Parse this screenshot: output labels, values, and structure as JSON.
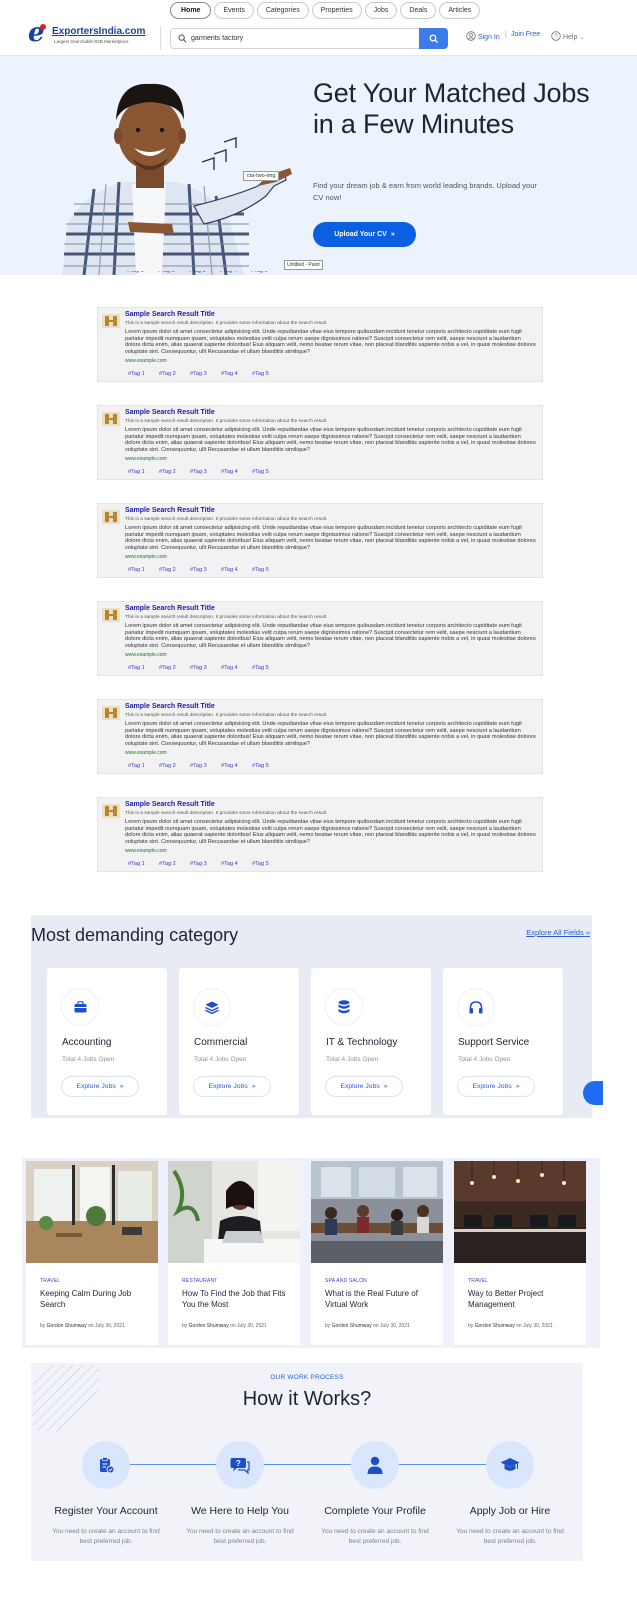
{
  "header": {
    "tabs": [
      "Home",
      "Events",
      "Categories",
      "Properties",
      "Jobs",
      "Deals",
      "Articles"
    ],
    "logo_name": "ExportersIndia.com",
    "logo_tagline": "Largest Searchable B2B Marketplace",
    "search_value": "garments factory",
    "sign_in": "Sign In",
    "divider": "|",
    "join_free": "Join Free",
    "help": "Help"
  },
  "hero": {
    "title": "Get Your Matched Jobs in a Few Minutes",
    "subtitle": "Find your dream job & earn from world leading brands. Upload your CV now!",
    "button": "Upload Your CV",
    "img_label": "cta-two-img",
    "paint_label": "Untitled - Paint"
  },
  "results": {
    "title": "Sample Search Result Title",
    "description": "This is a sample search result description. It provides some information about the search result.",
    "body": "Lorem ipsum dolor sit amet consectetur adipisicing elit. Unde repudiandae vitae eius tempore quibusdam incidunt tenetur corporis architecto cupiditate eum fugit pariatur impedit numquam ipsam, voluptates molestias velit culpa rerum saepe dignissimos ratione? Suscipit consectetur rem velit, saepe nesciunt a laudantium dolore dicta enim, alias quaerat sapiente doloribus! Eius aliquam velit, nemo beatae rerum vitae, non placeat blanditiis sapiente nobis a vel, in quasi molestiae dolores voluptate sint. Consequuntur, ullt Recusandae et ullam blanditiis similique?",
    "url": "www.example.com",
    "tags": [
      "#Tag 1",
      "#Tag 2",
      "#Tag 3",
      "#Tag 4",
      "#Tag 5"
    ]
  },
  "category": {
    "title": "Most demanding category",
    "explore_all": "Explore All Fields",
    "items": [
      {
        "name": "Accounting",
        "count": "Total 4 Jobs Open",
        "button": "Explore Jobs",
        "icon": "briefcase-icon"
      },
      {
        "name": "Commercial",
        "count": "Total 4 Jobs Open",
        "button": "Explore Jobs",
        "icon": "layers-icon"
      },
      {
        "name": "IT & Technology",
        "count": "Total 4 Jobs Open",
        "button": "Explore Jobs",
        "icon": "database-icon"
      },
      {
        "name": "Support Service",
        "count": "Total 4 Jobs Open",
        "button": "Explore Jobs",
        "icon": "headphones-icon"
      }
    ]
  },
  "blog": {
    "by": "by",
    "on": "on",
    "posts": [
      {
        "category": "TRAVEL",
        "title": "Keeping Calm During Job Search",
        "author": "Gordon Shumway",
        "date": "July 30, 2021"
      },
      {
        "category": "RESTAURANT",
        "title": "How To Find the Job that Fits You the Most",
        "author": "Gordon Shumway",
        "date": "July 30, 2021"
      },
      {
        "category": "SPA AND SALON",
        "title": "What is the Real Future of Virtual Work",
        "author": "Gordon Shumway",
        "date": "July 30, 2021"
      },
      {
        "category": "TRAVEL",
        "title": "Way to Better Project Management",
        "author": "Gordon Shumway",
        "date": "July 30, 2021"
      }
    ]
  },
  "how": {
    "kicker": "OUR WORK PROCESS",
    "title": "How it Works?",
    "steps": [
      {
        "name": "Register Your Account",
        "desc": "You need to create an account to find best preferred job.",
        "icon": "clipboard-check-icon"
      },
      {
        "name": "We Here to Help You",
        "desc": "You need to create an account to find best preferred job.",
        "icon": "chat-help-icon"
      },
      {
        "name": "Complete Your Profile",
        "desc": "You need to create an account to find best preferred job.",
        "icon": "user-icon"
      },
      {
        "name": "Apply Job or Hire",
        "desc": "You need to create an account to find best preferred job.",
        "icon": "graduation-cap-icon"
      }
    ]
  },
  "colors": {
    "brand_blue": "#0b5fe0",
    "link_blue": "#2a5bd7",
    "hero_bg": "#ecf3fd",
    "result_title": "#1a1aa6",
    "tag_color": "#4338ca"
  }
}
